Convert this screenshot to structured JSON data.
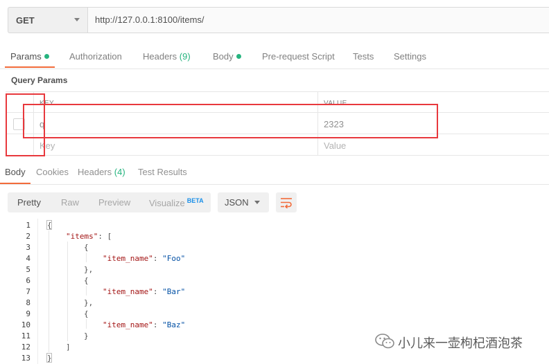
{
  "request": {
    "method": "GET",
    "url": "http://127.0.0.1:8100/items/"
  },
  "request_tabs": [
    {
      "label": "Params",
      "active": true,
      "dot": true
    },
    {
      "label": "Authorization"
    },
    {
      "label": "Headers",
      "count": "(9)"
    },
    {
      "label": "Body",
      "dot": true
    },
    {
      "label": "Pre-request Script"
    },
    {
      "label": "Tests"
    },
    {
      "label": "Settings"
    }
  ],
  "query_params": {
    "title": "Query Params",
    "columns": {
      "key": "KEY",
      "value": "VALUE"
    },
    "rows": [
      {
        "key": "q",
        "value": "2323",
        "checked": false
      }
    ],
    "placeholder": {
      "key": "Key",
      "value": "Value"
    }
  },
  "response_tabs": [
    {
      "label": "Body",
      "active": true
    },
    {
      "label": "Cookies"
    },
    {
      "label": "Headers",
      "count": "(4)"
    },
    {
      "label": "Test Results"
    }
  ],
  "body_toolbar": {
    "views": [
      "Pretty",
      "Raw",
      "Preview",
      "Visualize"
    ],
    "beta_badge": "BETA",
    "format": "JSON"
  },
  "response_body": {
    "line_numbers": [
      "1",
      "2",
      "3",
      "4",
      "5",
      "6",
      "7",
      "8",
      "9",
      "10",
      "11",
      "12",
      "13"
    ],
    "open_brace": "{",
    "items_key": "\"items\"",
    "items_open": ": [",
    "obj_open": "{",
    "field_key": "\"item_name\"",
    "colon": ": ",
    "values": [
      "\"Foo\"",
      "\"Bar\"",
      "\"Baz\""
    ],
    "obj_close_comma": "},",
    "obj_close": "}",
    "items_close": "]",
    "close_brace": "}"
  },
  "watermark": {
    "text": "小儿来一壶枸杞酒泡茶"
  },
  "colors": {
    "accent": "#f26b3a",
    "status_green": "#26b47f",
    "annotation_red": "#e8383d",
    "beta_blue": "#1a8fe8"
  }
}
